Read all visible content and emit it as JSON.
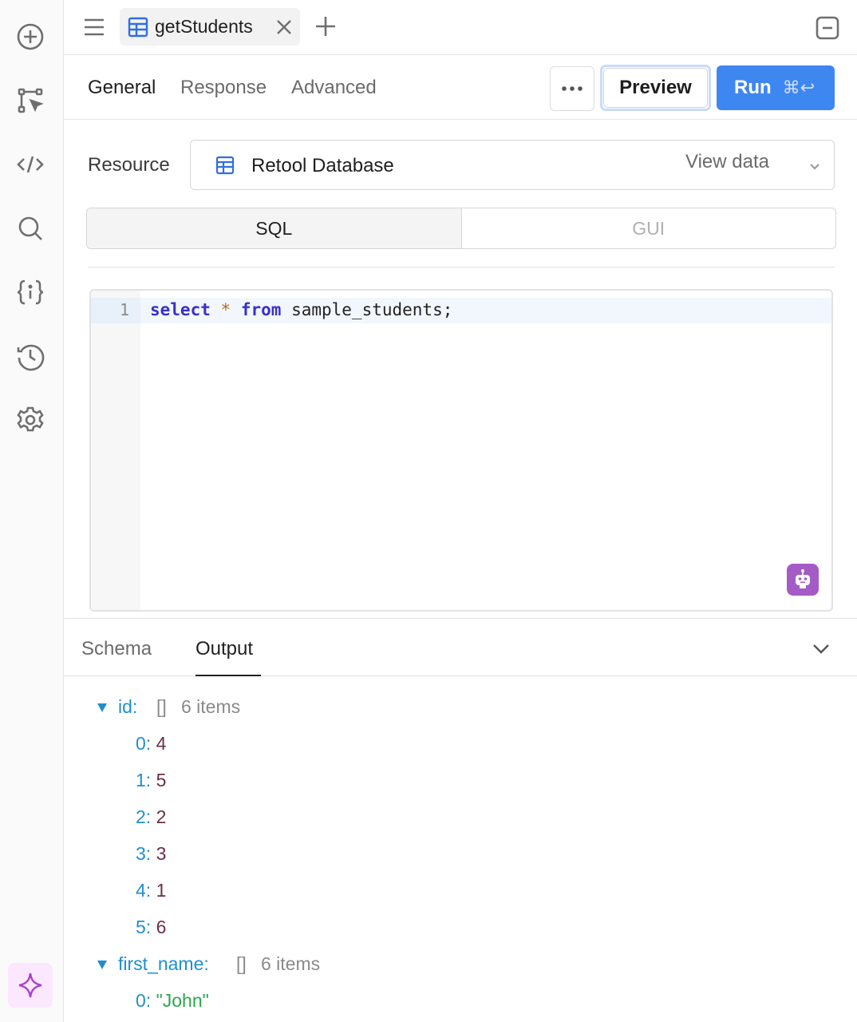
{
  "query_tab": {
    "name": "getStudents"
  },
  "toolbar": {
    "tabs": [
      "General",
      "Response",
      "Advanced"
    ],
    "active_tab": "General",
    "preview_label": "Preview",
    "run_label": "Run",
    "run_shortcut": "⌘↩"
  },
  "resource": {
    "label": "Resource",
    "value": "Retool Database",
    "view_data_label": "View data"
  },
  "mode": {
    "options": [
      "SQL",
      "GUI"
    ],
    "selected": "SQL"
  },
  "editor": {
    "line_number": "1",
    "code_tokens": [
      "select",
      "*",
      "from",
      "sample_students;"
    ]
  },
  "bottom_panel": {
    "tabs": [
      "Schema",
      "Output"
    ],
    "active_tab": "Output"
  },
  "output": {
    "id": {
      "key": "id:",
      "type": "[]",
      "count": "6 items",
      "items": [
        {
          "index": "0:",
          "value": "4"
        },
        {
          "index": "1:",
          "value": "5"
        },
        {
          "index": "2:",
          "value": "2"
        },
        {
          "index": "3:",
          "value": "3"
        },
        {
          "index": "4:",
          "value": "1"
        },
        {
          "index": "5:",
          "value": "6"
        }
      ]
    },
    "first_name": {
      "key": "first_name:",
      "type": "[]",
      "count": "6 items",
      "items": [
        {
          "index": "0:",
          "value": "\"John\""
        }
      ]
    }
  },
  "colors": {
    "accent": "#3f87f0",
    "json_key": "#1f8fcf",
    "json_number": "#6b2f4a",
    "json_string": "#2aa84a",
    "ai_purple": "#a45bc6"
  }
}
